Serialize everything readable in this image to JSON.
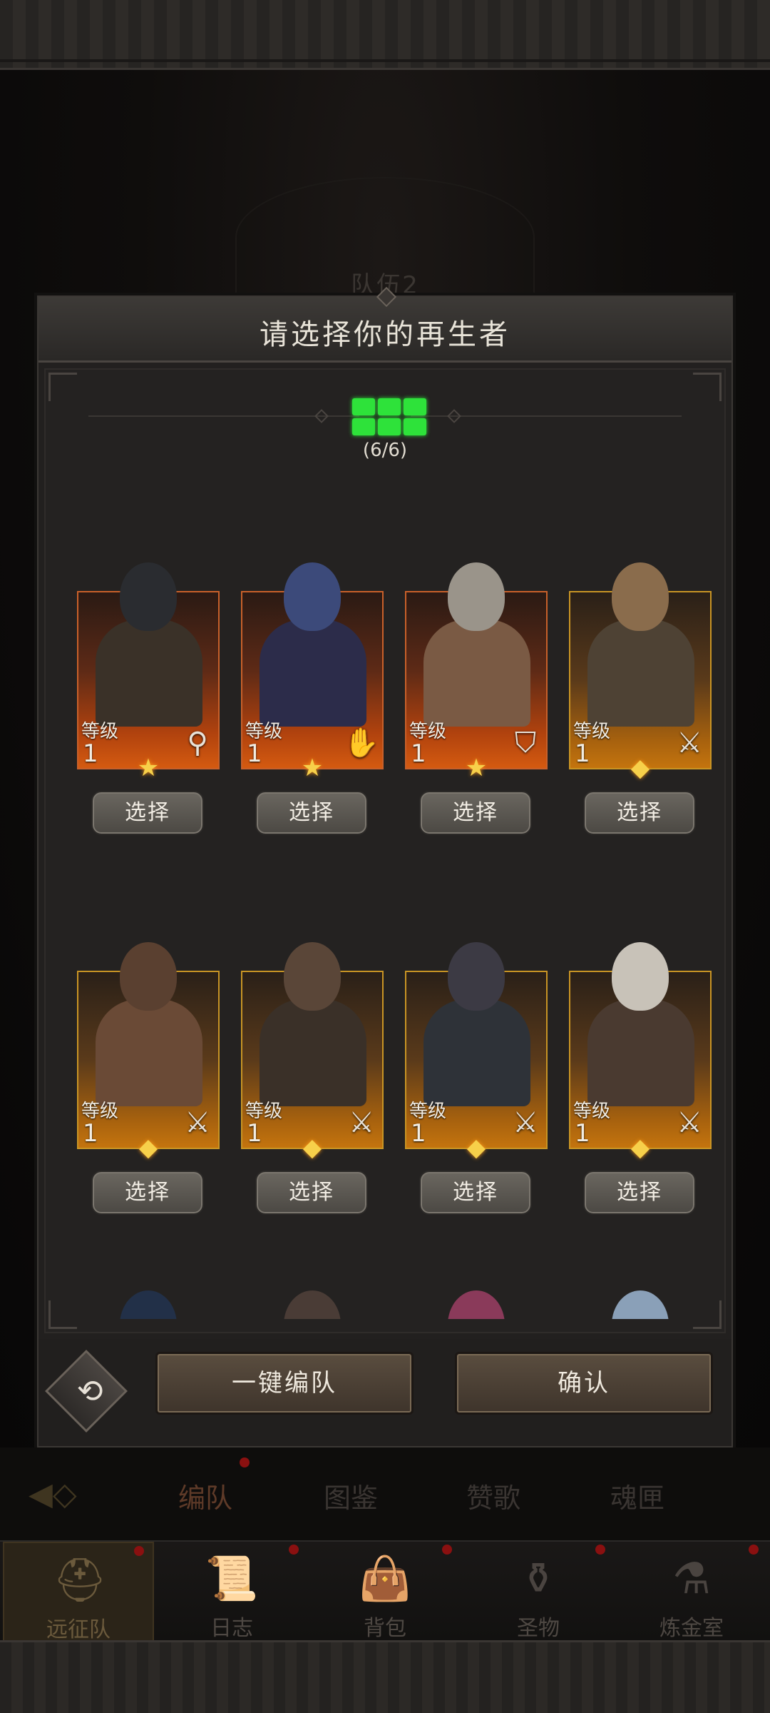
{
  "background": {
    "team_title": "队伍2"
  },
  "modal": {
    "title": "请选择你的再生者",
    "slot_count": "(6/6)",
    "slot_color": "#2ee23a",
    "heroes": [
      {
        "level_label": "等级",
        "level": "1",
        "class_icon": "staff-icon",
        "badge": "star",
        "rarity": "red",
        "select_label": "选择",
        "head_color": "#2a2c30",
        "body_color": "#3a3128"
      },
      {
        "level_label": "等级",
        "level": "1",
        "class_icon": "palm-icon",
        "badge": "star",
        "rarity": "red",
        "select_label": "选择",
        "head_color": "#3c4a7a",
        "body_color": "#2c2c4a"
      },
      {
        "level_label": "等级",
        "level": "1",
        "class_icon": "shield-icon",
        "badge": "star",
        "rarity": "red",
        "select_label": "选择",
        "head_color": "#9a948a",
        "body_color": "#7a5a44"
      },
      {
        "level_label": "等级",
        "level": "1",
        "class_icon": "sword-icon",
        "badge": "diamond",
        "rarity": "gold",
        "select_label": "选择",
        "head_color": "#8a6c4c",
        "body_color": "#4e4234"
      },
      {
        "level_label": "等级",
        "level": "1",
        "class_icon": "sword-icon",
        "badge": "diamond",
        "rarity": "gold",
        "select_label": "选择",
        "head_color": "#5a4030",
        "body_color": "#6a4a36"
      },
      {
        "level_label": "等级",
        "level": "1",
        "class_icon": "sword-icon",
        "badge": "diamond",
        "rarity": "gold",
        "select_label": "选择",
        "head_color": "#5a4638",
        "body_color": "#3a3028"
      },
      {
        "level_label": "等级",
        "level": "1",
        "class_icon": "sword-icon",
        "badge": "diamond",
        "rarity": "gold",
        "select_label": "选择",
        "head_color": "#3c3a44",
        "body_color": "#2e3238"
      },
      {
        "level_label": "等级",
        "level": "1",
        "class_icon": "sword-icon",
        "badge": "diamond",
        "rarity": "gold",
        "select_label": "选择",
        "head_color": "#c8c2b8",
        "body_color": "#4a3a30"
      }
    ],
    "partial_heroes": [
      {
        "head_color": "#223048"
      },
      {
        "head_color": "#4a3c36"
      },
      {
        "head_color": "#8a3a5a"
      },
      {
        "head_color": "#8aa0b8"
      }
    ],
    "footer": {
      "reset_icon": "undo-icon",
      "quick_team_label": "一键编队",
      "confirm_label": "确认"
    }
  },
  "sub_tabs": [
    "编队",
    "图鉴",
    "赞歌",
    "魂匣"
  ],
  "bottom_nav": [
    {
      "label": "远征队",
      "icon": "helmet-icon",
      "active": true
    },
    {
      "label": "日志",
      "icon": "scroll-icon",
      "active": false
    },
    {
      "label": "背包",
      "icon": "bag-icon",
      "active": false
    },
    {
      "label": "圣物",
      "icon": "relic-icon",
      "active": false
    },
    {
      "label": "炼金室",
      "icon": "alchemy-icon",
      "active": false
    }
  ]
}
